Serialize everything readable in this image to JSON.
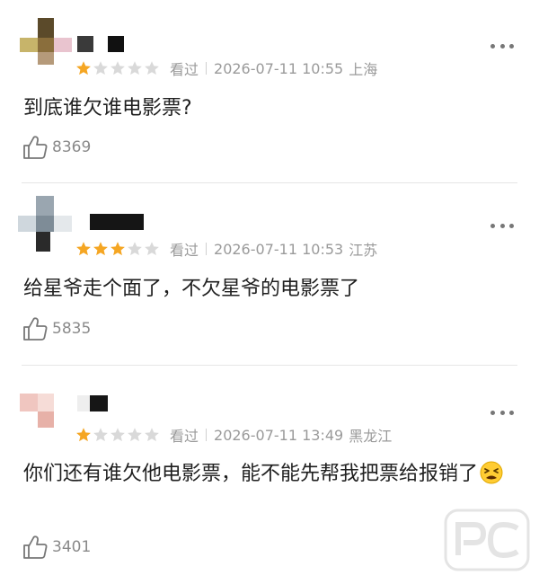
{
  "comments": [
    {
      "rating": 1,
      "watched_label": "看过",
      "datetime": "2026-07-11 10:55",
      "location": "上海",
      "text": "到底谁欠谁电影票?",
      "likes": "8369"
    },
    {
      "rating": 3,
      "watched_label": "看过",
      "datetime": "2026-07-11 10:53",
      "location": "江苏",
      "text": "给星爷走个面了，不欠星爷的电影票了",
      "likes": "5835"
    },
    {
      "rating": 1,
      "watched_label": "看过",
      "datetime": "2026-07-11 13:49",
      "location": "黑龙江",
      "text": "你们还有谁欠他电影票，能不能先帮我把票给报销了",
      "emoji": "tired-face-emoji",
      "likes": "3401"
    }
  ],
  "rating_max": 5,
  "colors": {
    "star_on": "#f5a623",
    "star_off": "#d9d9d9",
    "meta_text": "#9a9a9a",
    "divider": "#e6e6e6"
  },
  "icons": {
    "more": "more-dots-icon",
    "like": "thumbs-up-icon",
    "star": "star-icon"
  }
}
